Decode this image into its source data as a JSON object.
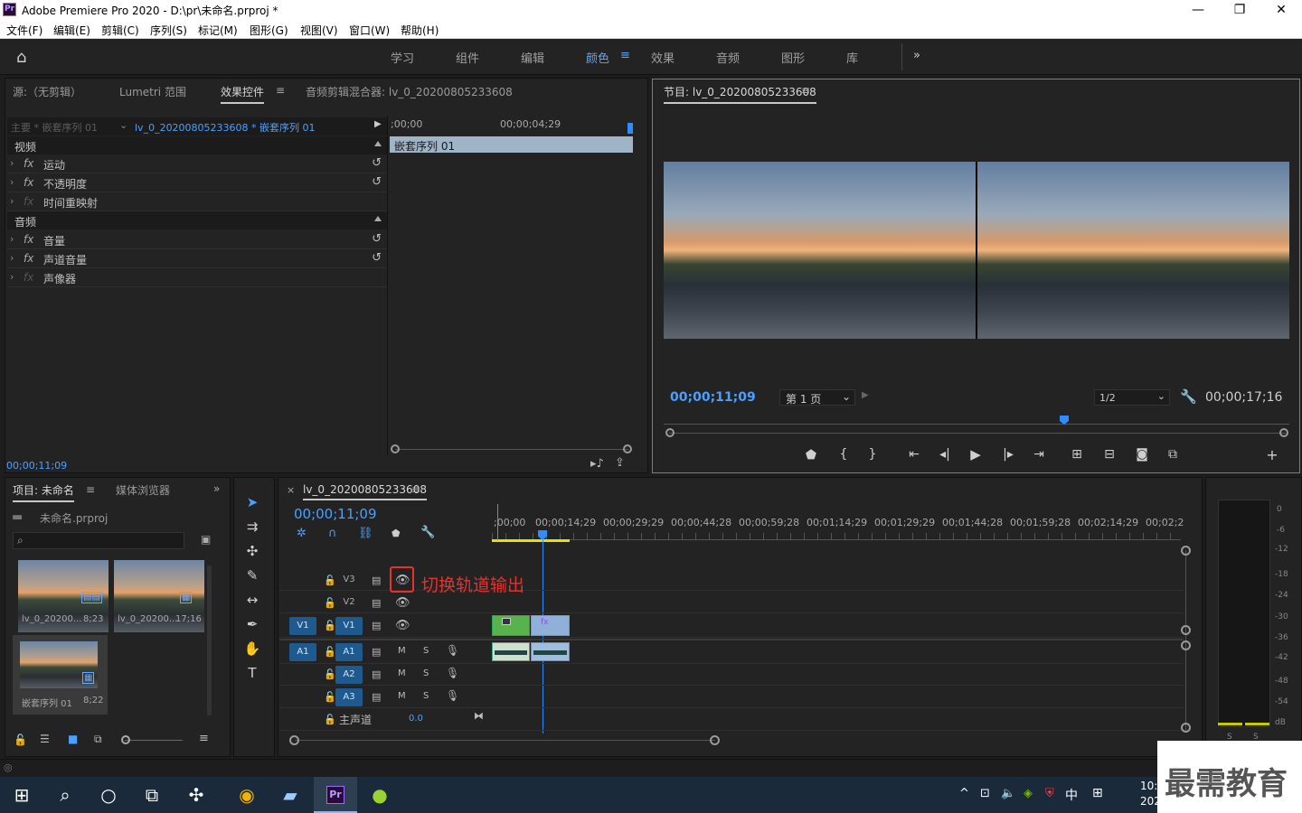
{
  "window": {
    "title": "Adobe Premiere Pro 2020 - D:\\pr\\未命名.prproj *",
    "app_badge": "Pr",
    "controls": [
      "—",
      "❐",
      "✕"
    ]
  },
  "menu": [
    "文件(F)",
    "编辑(E)",
    "剪辑(C)",
    "序列(S)",
    "标记(M)",
    "图形(G)",
    "视图(V)",
    "窗口(W)",
    "帮助(H)"
  ],
  "workspaces": {
    "items": [
      "学习",
      "组件",
      "编辑",
      "颜色",
      "效果",
      "音频",
      "图形",
      "库"
    ],
    "active": "颜色",
    "more": "»"
  },
  "effect_panel": {
    "tabs": [
      "源:（无剪辑）",
      "Lumetri 范围",
      "效果控件",
      "音频剪辑混合器: lv_0_20200805233608"
    ],
    "active_tab": "效果控件",
    "master": "主要 * 嵌套序列 01",
    "clip": "lv_0_20200805233608 * 嵌套序列 01",
    "ruler_start": ";00;00",
    "ruler_mid": "00;00;04;29",
    "nested_clip": "嵌套序列 01",
    "video_section": "视频",
    "video_effects": [
      "运动",
      "不透明度",
      "时间重映射"
    ],
    "audio_section": "音频",
    "audio_effects": [
      "音量",
      "声道音量",
      "声像器"
    ],
    "timecode": "00;00;11;09"
  },
  "program_monitor": {
    "title": "节目: lv_0_20200805233608",
    "timecode": "00;00;11;09",
    "page_select": "第 1 页",
    "zoom_select": "1/2",
    "duration": "00;00;17;16"
  },
  "project_panel": {
    "tabs": [
      "项目: 未命名",
      "媒体浏览器"
    ],
    "active_tab": "项目: 未命名",
    "file": "未命名.prproj",
    "search_placeholder": "",
    "items": [
      {
        "name": "lv_0_20200...",
        "duration": "8;23"
      },
      {
        "name": "lv_0_20200...",
        "duration": "17;16"
      },
      {
        "name": "嵌套序列 01",
        "duration": "8;22"
      }
    ]
  },
  "timeline": {
    "sequence": "lv_0_20200805233608",
    "timecode": "00;00;11;09",
    "ruler": [
      ";00;00",
      "00;00;14;29",
      "00;00;29;29",
      "00;00;44;28",
      "00;00;59;28",
      "00;01;14;29",
      "00;01;29;29",
      "00;01;44;28",
      "00;01;59;28",
      "00;02;14;29",
      "00;02;2"
    ],
    "video_tracks": [
      "V3",
      "V2",
      "V1"
    ],
    "audio_tracks": [
      "A1",
      "A2",
      "A3"
    ],
    "source_v": "V1",
    "source_a": "A1",
    "master": "主声道",
    "master_value": "0.0",
    "mute": "M",
    "solo": "S",
    "annotation": "切换轨道输出"
  },
  "audio_meter": {
    "scale": [
      "0",
      "-6",
      "-12",
      "-18",
      "-24",
      "-30",
      "-36",
      "-42",
      "-48",
      "-54",
      "dB"
    ],
    "solo_labels": [
      "S",
      "S"
    ]
  },
  "watermark": "最需教育",
  "taskbar": {
    "ime": "中",
    "clock": "10:",
    "date": "202"
  },
  "colors": {
    "accent": "#4aa0ff",
    "annotation": "#e8312c",
    "panel": "#232323"
  }
}
